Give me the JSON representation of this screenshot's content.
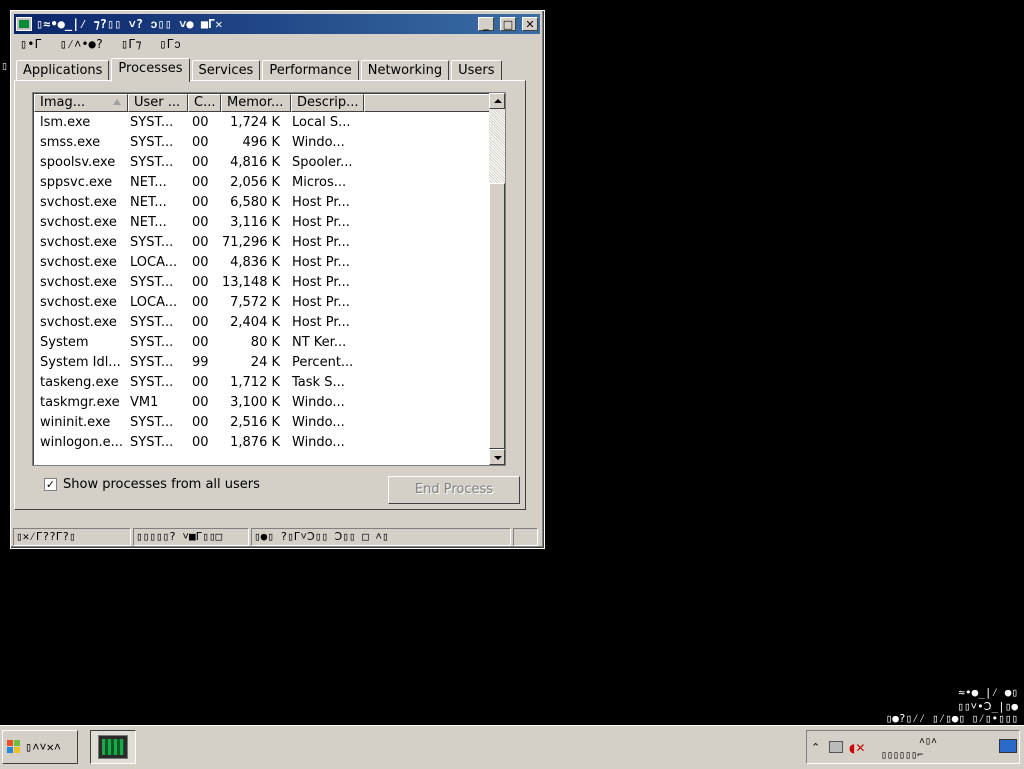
{
  "window": {
    "title": "▯≈•●_|⁄ ⁊?▯▯ ˅? ↄ▯▯ ˅● ■Г✕",
    "menu": [
      "▯•Г",
      "▯⁄˄•●?",
      "▯Г⁊",
      "▯Гↄ"
    ],
    "controls": {
      "minimize": "_",
      "maximize": "□",
      "close": "✕"
    }
  },
  "desktop_indicator": "▯",
  "tabs": [
    "Applications",
    "Processes",
    "Services",
    "Performance",
    "Networking",
    "Users"
  ],
  "active_tab": "Processes",
  "columns": [
    "Imag...",
    "User ...",
    "C...",
    "Memor...",
    "Descrip..."
  ],
  "processes": [
    {
      "image": "lsm.exe",
      "user": "SYST...",
      "cpu": "00",
      "mem": "1,724 K",
      "desc": "Local S..."
    },
    {
      "image": "smss.exe",
      "user": "SYST...",
      "cpu": "00",
      "mem": "496 K",
      "desc": "Windo..."
    },
    {
      "image": "spoolsv.exe",
      "user": "SYST...",
      "cpu": "00",
      "mem": "4,816 K",
      "desc": "Spooler..."
    },
    {
      "image": "sppsvc.exe",
      "user": "NET...",
      "cpu": "00",
      "mem": "2,056 K",
      "desc": "Micros..."
    },
    {
      "image": "svchost.exe",
      "user": "NET...",
      "cpu": "00",
      "mem": "6,580 K",
      "desc": "Host Pr..."
    },
    {
      "image": "svchost.exe",
      "user": "NET...",
      "cpu": "00",
      "mem": "3,116 K",
      "desc": "Host Pr..."
    },
    {
      "image": "svchost.exe",
      "user": "SYST...",
      "cpu": "00",
      "mem": "71,296 K",
      "desc": "Host Pr..."
    },
    {
      "image": "svchost.exe",
      "user": "LOCA...",
      "cpu": "00",
      "mem": "4,836 K",
      "desc": "Host Pr..."
    },
    {
      "image": "svchost.exe",
      "user": "SYST...",
      "cpu": "00",
      "mem": "13,148 K",
      "desc": "Host Pr..."
    },
    {
      "image": "svchost.exe",
      "user": "LOCA...",
      "cpu": "00",
      "mem": "7,572 K",
      "desc": "Host Pr..."
    },
    {
      "image": "svchost.exe",
      "user": "SYST...",
      "cpu": "00",
      "mem": "2,404 K",
      "desc": "Host Pr..."
    },
    {
      "image": "System",
      "user": "SYST...",
      "cpu": "00",
      "mem": "80 K",
      "desc": "NT Ker..."
    },
    {
      "image": "System Idl...",
      "user": "SYST...",
      "cpu": "99",
      "mem": "24 K",
      "desc": "Percent..."
    },
    {
      "image": "taskeng.exe",
      "user": "SYST...",
      "cpu": "00",
      "mem": "1,712 K",
      "desc": "Task S..."
    },
    {
      "image": "taskmgr.exe",
      "user": "VM1",
      "cpu": "00",
      "mem": "3,100 K",
      "desc": "Windo..."
    },
    {
      "image": "wininit.exe",
      "user": "SYST...",
      "cpu": "00",
      "mem": "2,516 K",
      "desc": "Windo..."
    },
    {
      "image": "winlogon.e...",
      "user": "SYST...",
      "cpu": "00",
      "mem": "1,876 K",
      "desc": "Windo..."
    }
  ],
  "show_all_label": "Show processes from all users",
  "show_all_checked": "✓",
  "end_process_label": "End Process",
  "status": [
    "▯✕⁄Г??Г?▯",
    "▯▯▯▯▯? ˅■Г▯▯□",
    "▯●▯ ?▯Г˅Ↄ▯▯ Ↄ▯▯ □ ˄▯"
  ],
  "tray_lines": [
    "≈•●_|⁄ ●▯",
    "▯▯˅•Ↄ_|▯●",
    "▯●?▯⁄⁄ ▯⁄▯●▯ ▯⁄▯•▯▯▯"
  ],
  "start_label": "▯˄˅✕˄",
  "clock_lines": [
    "˄▯˄",
    "▯▯▯▯▯▯⌐"
  ],
  "colors": {
    "window_bg": "#d4d0c8",
    "title_start": "#0a246a",
    "title_end": "#3a6ea5",
    "desktop": "#000000"
  }
}
